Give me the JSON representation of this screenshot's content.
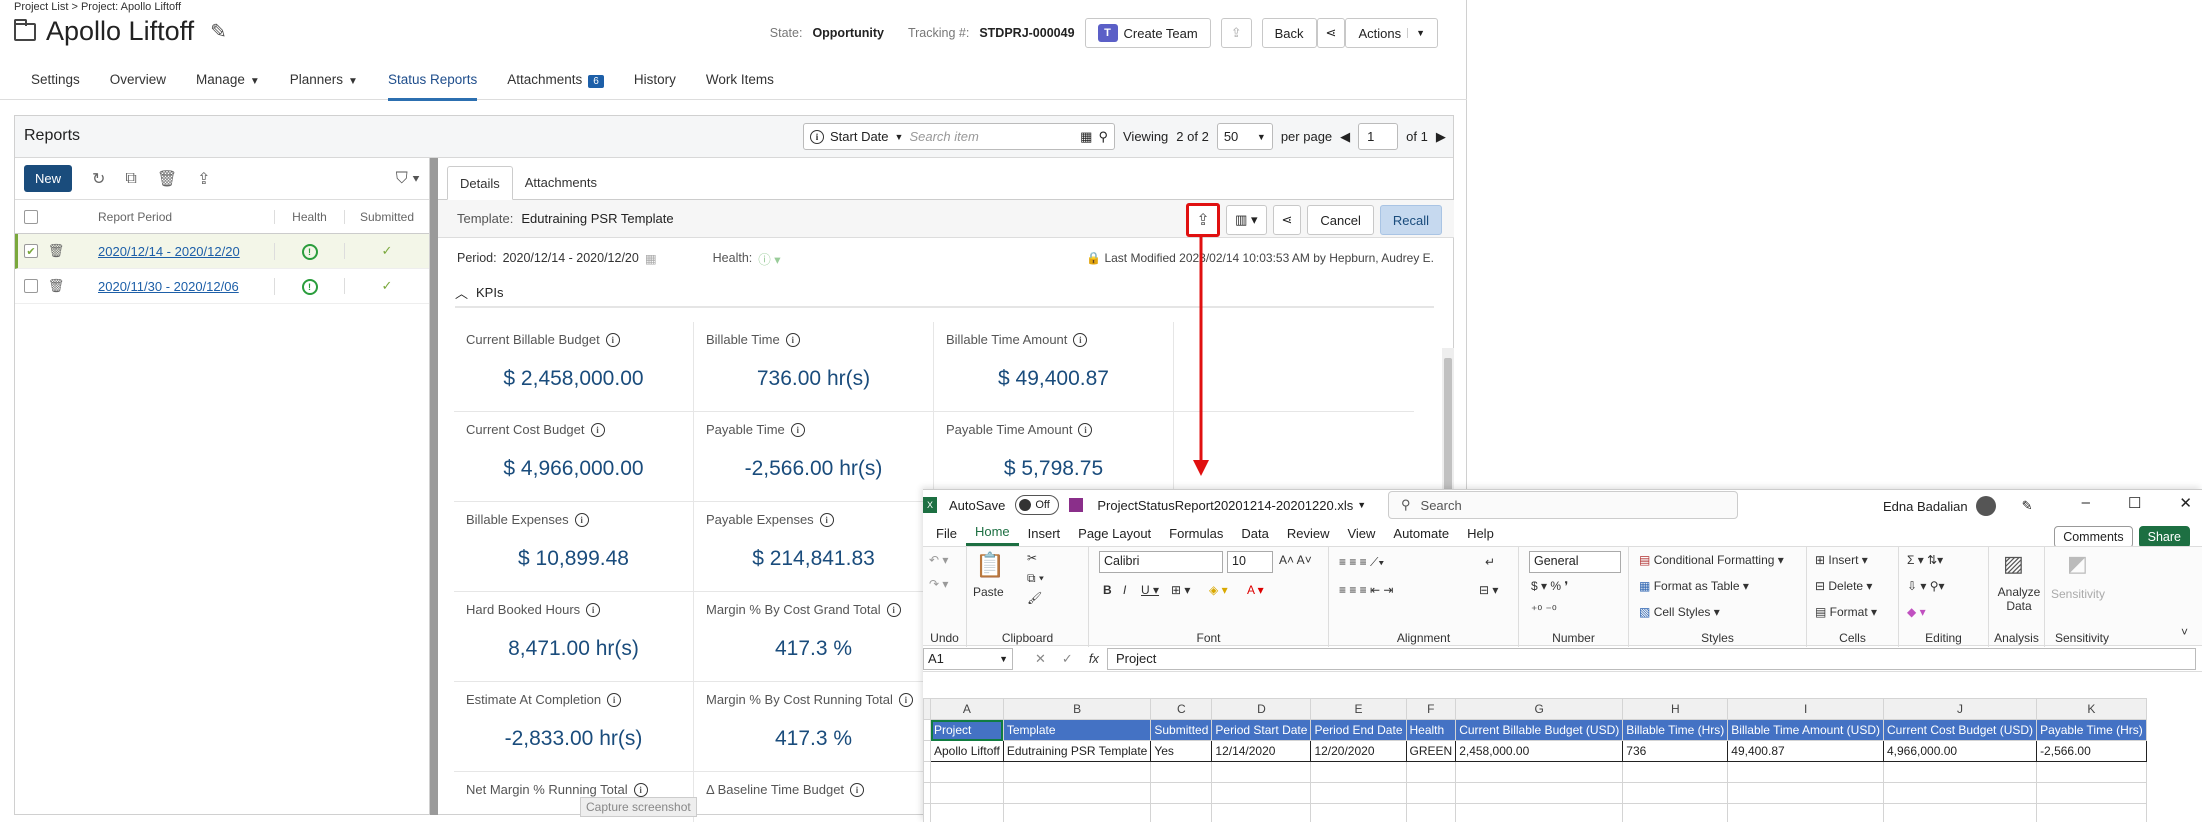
{
  "breadcrumb": "Project List > Project: Apollo Liftoff",
  "project": {
    "title": "Apollo Liftoff"
  },
  "header": {
    "state_label": "State:",
    "state_value": "Opportunity",
    "tracking_label": "Tracking #:",
    "tracking_value": "STDPRJ-000049",
    "create_team": "Create Team",
    "back": "Back",
    "actions": "Actions"
  },
  "tabs": [
    {
      "label": "Settings"
    },
    {
      "label": "Overview"
    },
    {
      "label": "Manage"
    },
    {
      "label": "Planners"
    },
    {
      "label": "Status Reports"
    },
    {
      "label": "Attachments",
      "badge": "6"
    },
    {
      "label": "History"
    },
    {
      "label": "Work Items"
    }
  ],
  "reports": {
    "title": "Reports",
    "search_field": "Start Date",
    "search_placeholder": "Search item",
    "viewing": "Viewing",
    "viewing_count": "2 of 2",
    "per_page_value": "50",
    "per_page_label": "per page",
    "page_value": "1",
    "page_of": "of 1",
    "new_button": "New",
    "columns": {
      "period": "Report Period",
      "health": "Health",
      "submitted": "Submitted"
    },
    "rows": [
      {
        "period": "2020/12/14 - 2020/12/20"
      },
      {
        "period": "2020/11/30 - 2020/12/06"
      }
    ]
  },
  "details": {
    "tabs": [
      "Details",
      "Attachments"
    ],
    "template_label": "Template:",
    "template_value": "Edutraining PSR Template",
    "cancel": "Cancel",
    "recall": "Recall",
    "period_label": "Period:",
    "period_value": "2020/12/14 - 2020/12/20",
    "health_label": "Health:",
    "last_modified": "Last Modified 2023/02/14 10:03:53 AM by Hepburn, Audrey E.",
    "kpi_header": "KPIs",
    "kpis": [
      [
        {
          "label": "Current Billable Budget",
          "value": "$ 2,458,000.00"
        },
        {
          "label": "Billable Time",
          "value": "736.00 hr(s)"
        },
        {
          "label": "Billable Time Amount",
          "value": "$ 49,400.87"
        }
      ],
      [
        {
          "label": "Current Cost Budget",
          "value": "$ 4,966,000.00"
        },
        {
          "label": "Payable Time",
          "value": "-2,566.00 hr(s)"
        },
        {
          "label": "Payable Time Amount",
          "value": "$ 5,798.75"
        }
      ],
      [
        {
          "label": "Billable Expenses",
          "value": "$ 10,899.48"
        },
        {
          "label": "Payable Expenses",
          "value": "$ 214,841.83"
        }
      ],
      [
        {
          "label": "Hard Booked Hours",
          "value": "8,471.00 hr(s)"
        },
        {
          "label": "Margin % By Cost Grand Total",
          "value": "417.3 %"
        }
      ],
      [
        {
          "label": "Estimate At Completion",
          "value": "-2,833.00 hr(s)"
        },
        {
          "label": "Margin % By Cost Running Total",
          "value": "417.3 %"
        }
      ],
      [
        {
          "label": "Net Margin % Running Total",
          "value": ""
        },
        {
          "label": "Δ Baseline Time Budget",
          "value": ""
        }
      ]
    ],
    "tooltip": "Capture screenshot"
  },
  "excel": {
    "autosave": "AutoSave",
    "autosave_state": "Off",
    "filename": "ProjectStatusReport20201214-20201220.xls",
    "search_placeholder": "Search",
    "user": "Edna Badalian",
    "menu": [
      "File",
      "Home",
      "Insert",
      "Page Layout",
      "Formulas",
      "Data",
      "Review",
      "View",
      "Automate",
      "Help"
    ],
    "comments": "Comments",
    "share": "Share",
    "ribbon": {
      "undo": "Undo",
      "paste": "Paste",
      "clipboard": "Clipboard",
      "font_name": "Calibri",
      "font_size": "10",
      "font": "Font",
      "alignment": "Alignment",
      "number_format": "General",
      "number": "Number",
      "conditional": "Conditional Formatting",
      "format_table": "Format as Table",
      "cell_styles": "Cell Styles",
      "styles": "Styles",
      "insert": "Insert",
      "delete": "Delete",
      "format": "Format",
      "cells": "Cells",
      "editing": "Editing",
      "analyze": "Analyze Data",
      "analysis": "Analysis",
      "sensitivity": "Sensitivity"
    },
    "namebox": "A1",
    "formula": "Project",
    "col_letters": [
      "A",
      "B",
      "C",
      "D",
      "E",
      "F",
      "G",
      "H",
      "I",
      "J",
      "K"
    ],
    "headers": [
      "Project",
      "Template",
      "Submitted",
      "Period Start Date",
      "Period End Date",
      "Health",
      "Current Billable Budget (USD)",
      "Billable Time (Hrs)",
      "Billable Time Amount (USD)",
      "Current Cost Budget (USD)",
      "Payable Time (Hrs)"
    ],
    "row": [
      "Apollo Liftoff",
      "Edutraining PSR Template",
      "Yes",
      "12/14/2020",
      "12/20/2020",
      "GREEN",
      "2,458,000.00",
      "736",
      "49,400.87",
      "4,966,000.00",
      "-2,566.00"
    ]
  }
}
